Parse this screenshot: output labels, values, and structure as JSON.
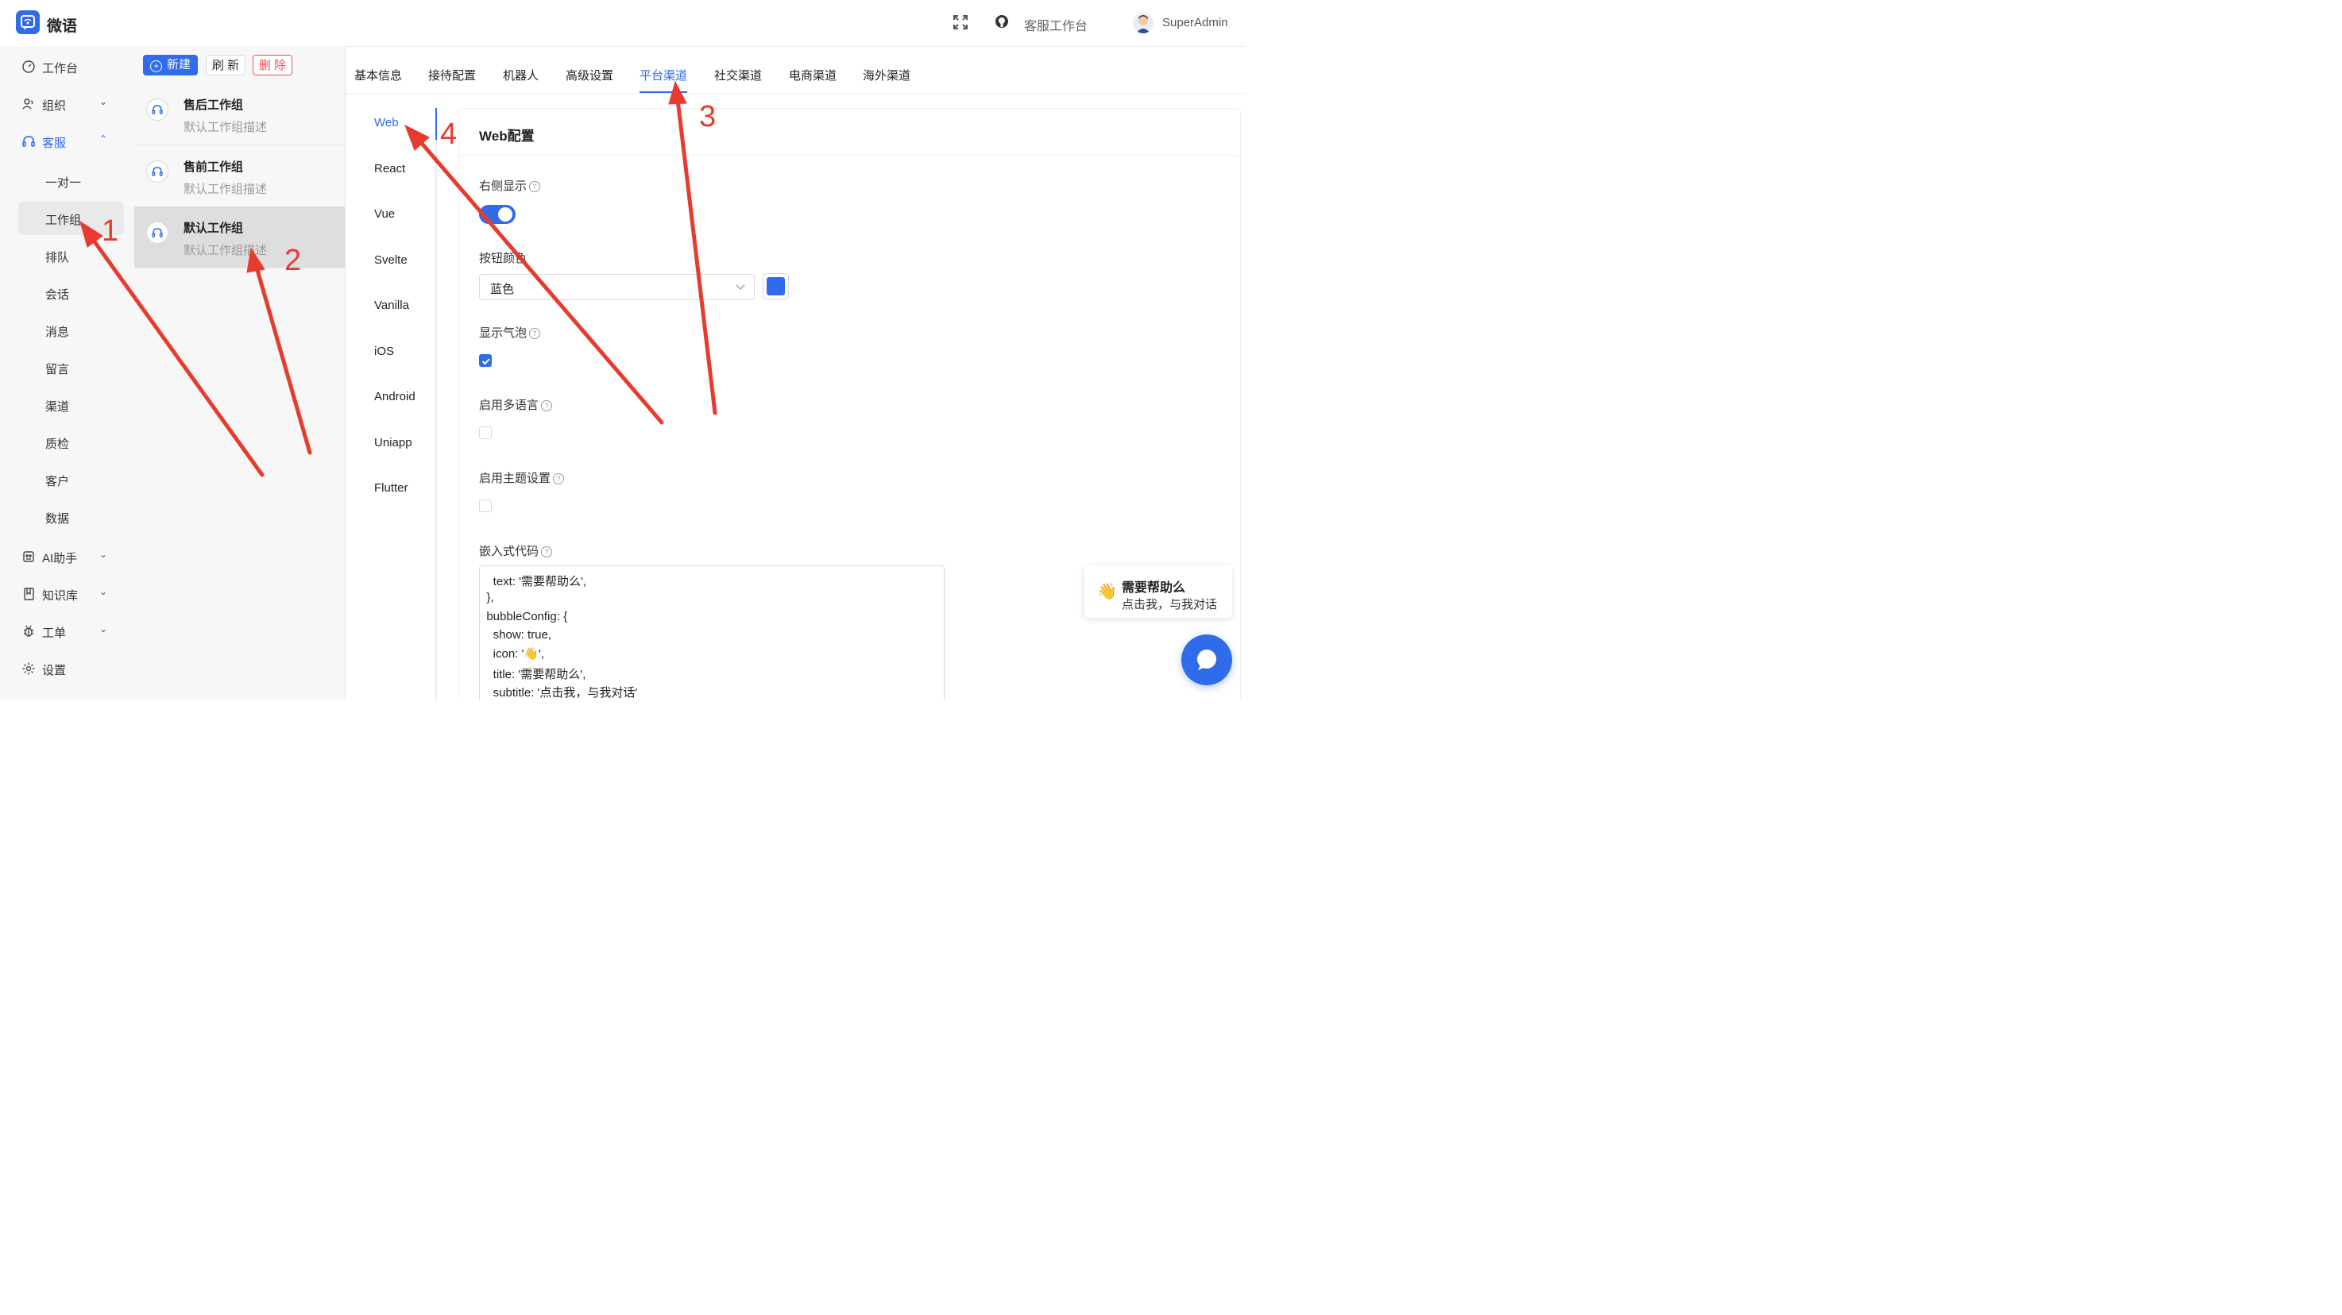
{
  "header": {
    "app_name": "微语",
    "agent_workbench": "客服工作台",
    "user_name": "SuperAdmin",
    "icons": [
      "fullscreen-icon",
      "github-icon"
    ]
  },
  "sidebar": {
    "items": [
      {
        "label": "工作台",
        "icon": "dashboard-icon"
      },
      {
        "label": "组织",
        "icon": "user-group-icon",
        "chevron": "⌄"
      },
      {
        "label": "客服",
        "icon": "headset-icon",
        "chevron": "⌃"
      },
      {
        "label": "AI助手",
        "icon": "robot-icon",
        "chevron": "⌄"
      },
      {
        "label": "知识库",
        "icon": "book-icon",
        "chevron": "⌄"
      },
      {
        "label": "工单",
        "icon": "bug-icon",
        "chevron": "⌄"
      },
      {
        "label": "设置",
        "icon": "gear-icon"
      }
    ],
    "sub_items": [
      "一对一",
      "工作组",
      "排队",
      "会话",
      "消息",
      "留言",
      "渠道",
      "质检",
      "客户",
      "数据"
    ]
  },
  "toolbar": {
    "new_label": "新建",
    "refresh_label": "刷 新",
    "delete_label": "删 除"
  },
  "groups": [
    {
      "name": "售后工作组",
      "desc": "默认工作组描述"
    },
    {
      "name": "售前工作组",
      "desc": "默认工作组描述"
    },
    {
      "name": "默认工作组",
      "desc": "默认工作组描述"
    }
  ],
  "tabs": [
    "基本信息",
    "接待配置",
    "机器人",
    "高级设置",
    "平台渠道",
    "社交渠道",
    "电商渠道",
    "海外渠道"
  ],
  "platforms": [
    "Web",
    "React",
    "Vue",
    "Svelte",
    "Vanilla",
    "iOS",
    "Android",
    "Uniapp",
    "Flutter"
  ],
  "config": {
    "title": "Web配置",
    "show_right": "右侧显示",
    "button_color": "按钮颜色",
    "button_color_value": "蓝色",
    "show_bubble": "显示气泡",
    "enable_multilang": "启用多语言",
    "enable_theme": "启用主题设置",
    "embed_code": "嵌入式代码",
    "code_lines": [
      "    text: '需要帮助么',",
      "  },",
      "  bubbleConfig: {",
      "    show: true,",
      "    icon: '👋',",
      "    title: '需要帮助么',",
      "    subtitle: '点击我，与我对话'"
    ]
  },
  "bubble": {
    "icon": "👋",
    "title": "需要帮助么",
    "subtitle": "点击我，与我对话"
  },
  "annotations": [
    "1",
    "2",
    "3",
    "4"
  ],
  "colors": {
    "accent": "#2f6bea",
    "danger": "#ff4d4f",
    "arrow": "#e63b2e"
  }
}
